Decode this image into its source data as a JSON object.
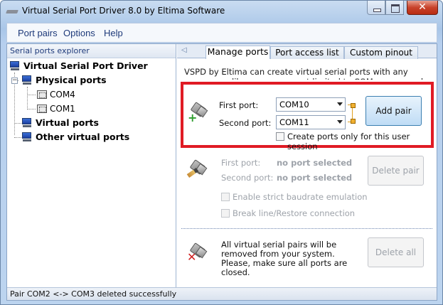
{
  "window": {
    "title": "Virtual Serial Port Driver 8.0 by Eltima Software",
    "close_glyph": "✕"
  },
  "menu": [
    "Port pairs",
    "Options",
    "Help"
  ],
  "explorer": {
    "header": "Serial ports explorer",
    "root": "Virtual Serial Port Driver",
    "physical_ports": "Physical ports",
    "ports": [
      "COM4",
      "COM1"
    ],
    "virtual_ports": "Virtual ports",
    "other_virtual_ports": "Other virtual ports"
  },
  "tabs": [
    "Manage ports",
    "Port access list",
    "Custom pinout"
  ],
  "manage": {
    "intro": "VSPD by Eltima can create virtual serial ports with any names you like, so you are not limited to COMx names only.",
    "add": {
      "first_port_label": "First port:",
      "second_port_label": "Second port:",
      "first_port_value": "COM10",
      "second_port_value": "COM11",
      "checkbox_label": "Create ports only for this user session",
      "button": "Add pair"
    },
    "delete_pair": {
      "first_port_label": "First port:",
      "second_port_label": "Second port:",
      "first_port_value": "no port selected",
      "second_port_value": "no port selected",
      "button": "Delete pair",
      "strict_baudrate": "Enable strict baudrate emulation",
      "break_line": "Break line/Restore connection"
    },
    "delete_all": {
      "text_lines": [
        "All virtual serial pairs will be",
        "removed from your system.",
        "Please, make sure all ports are",
        "closed."
      ],
      "button": "Delete all"
    }
  },
  "status": "Pair COM2 <-> COM3 deleted successfully"
}
